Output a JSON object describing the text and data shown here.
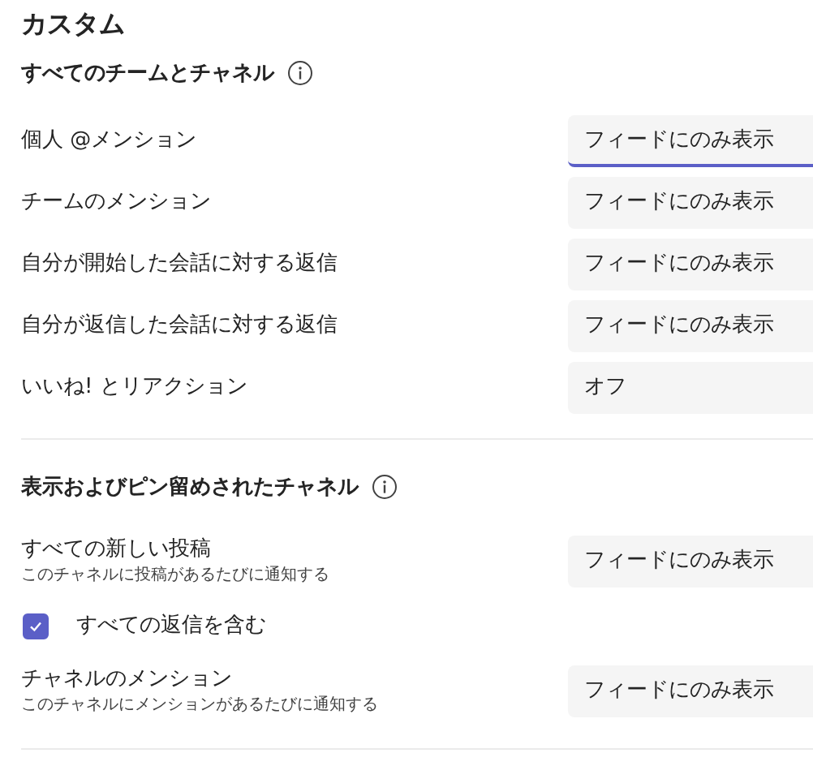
{
  "title": "カスタム",
  "sections": [
    {
      "heading": "すべてのチームとチャネル",
      "rows": [
        {
          "kind": "select",
          "label": "個人 @メンション",
          "value": "フィードにのみ表示",
          "focused": true
        },
        {
          "kind": "select",
          "label": "チームのメンション",
          "value": "フィードにのみ表示",
          "focused": false
        },
        {
          "kind": "select",
          "label": "自分が開始した会話に対する返信",
          "value": "フィードにのみ表示",
          "focused": false
        },
        {
          "kind": "select",
          "label": "自分が返信した会話に対する返信",
          "value": "フィードにのみ表示",
          "focused": false
        },
        {
          "kind": "select",
          "label": "いいね! とリアクション",
          "value": "オフ",
          "focused": false
        }
      ]
    },
    {
      "heading": "表示およびピン留めされたチャネル",
      "rows": [
        {
          "kind": "select",
          "label": "すべての新しい投稿",
          "description": "このチャネルに投稿があるたびに通知する",
          "value": "フィードにのみ表示",
          "focused": false
        },
        {
          "kind": "checkbox",
          "label": "すべての返信を含む",
          "checked": true
        },
        {
          "kind": "select",
          "label": "チャネルのメンション",
          "description": "このチャネルにメンションがあるたびに通知する",
          "value": "フィードにのみ表示",
          "focused": false
        }
      ]
    }
  ]
}
